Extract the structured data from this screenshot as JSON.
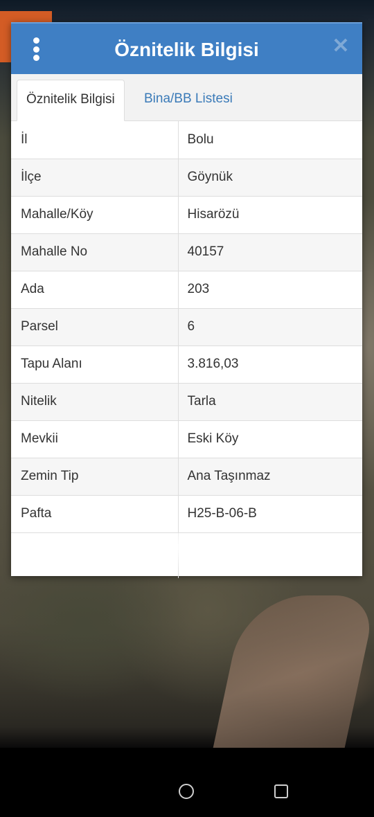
{
  "dialog": {
    "title": "Öznitelik Bilgisi",
    "menu_icon": "more-vertical-icon",
    "close_icon": "close-icon"
  },
  "tabs": [
    {
      "label": "Öznitelik Bilgisi",
      "active": true
    },
    {
      "label": "Bina/BB Listesi",
      "active": false
    }
  ],
  "rows": [
    {
      "key": "İl",
      "value": "Bolu"
    },
    {
      "key": "İlçe",
      "value": "Göynük"
    },
    {
      "key": "Mahalle/Köy",
      "value": "Hisarözü"
    },
    {
      "key": "Mahalle No",
      "value": "40157"
    },
    {
      "key": "Ada",
      "value": "203"
    },
    {
      "key": "Parsel",
      "value": "6"
    },
    {
      "key": "Tapu Alanı",
      "value": "3.816,03"
    },
    {
      "key": "Nitelik",
      "value": "Tarla"
    },
    {
      "key": "Mevkii",
      "value": "Eski Köy"
    },
    {
      "key": "Zemin Tip",
      "value": "Ana Taşınmaz"
    },
    {
      "key": "Pafta",
      "value": "H25-B-06-B"
    }
  ],
  "navbar": {
    "home_icon": "home-icon",
    "recents_icon": "recents-icon"
  },
  "colors": {
    "header": "#3f7fc4",
    "tab_link": "#3a7ab8",
    "accent": "#d35c25"
  }
}
